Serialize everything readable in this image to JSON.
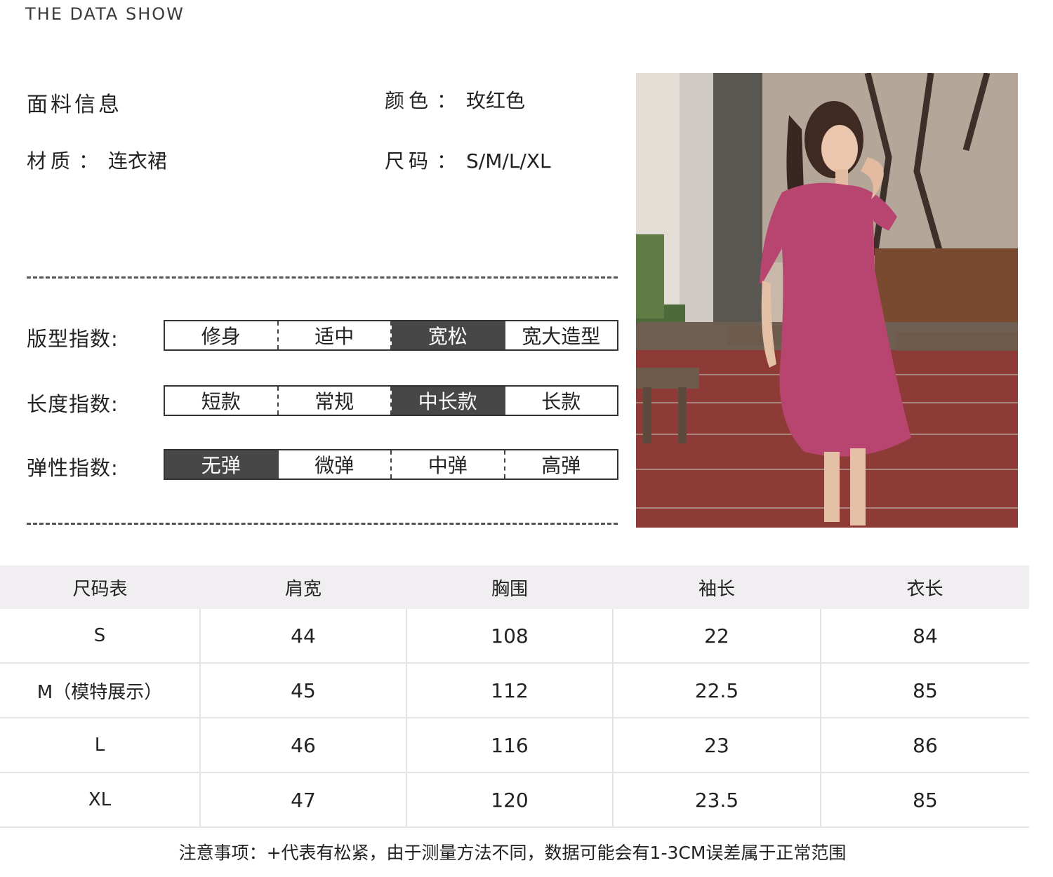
{
  "brand": "THE DATA SHOW",
  "info": {
    "title": "面料信息",
    "material_label": "材质",
    "material_value": "连衣裙",
    "color_label": "颜色",
    "color_value": "玫红色",
    "size_label": "尺码",
    "size_value": "S/M/L/XL",
    "separator": "："
  },
  "indices": [
    {
      "label": "版型指数:",
      "options": [
        "修身",
        "适中",
        "宽松",
        "宽大造型"
      ],
      "selected": 2
    },
    {
      "label": "长度指数:",
      "options": [
        "短款",
        "常规",
        "中长款",
        "长款"
      ],
      "selected": 2
    },
    {
      "label": "弹性指数:",
      "options": [
        "无弹",
        "微弹",
        "中弹",
        "高弹"
      ],
      "selected": 0
    }
  ],
  "size_table": {
    "headers": [
      "尺码表",
      "肩宽",
      "胸围",
      "袖长",
      "衣长"
    ],
    "rows": [
      [
        "S",
        "44",
        "108",
        "22",
        "84"
      ],
      [
        "M（模特展示）",
        "45",
        "112",
        "22.5",
        "85"
      ],
      [
        "L",
        "46",
        "116",
        "23",
        "86"
      ],
      [
        "XL",
        "47",
        "120",
        "23.5",
        "85"
      ]
    ]
  },
  "note": "注意事项：+代表有松紧，由于测量方法不同，数据可能会有1-3CM误差属于正常范围",
  "colors": {
    "selected_bg": "#474747",
    "table_header_bg": "#f0eef0",
    "dress": "#b8456f"
  }
}
